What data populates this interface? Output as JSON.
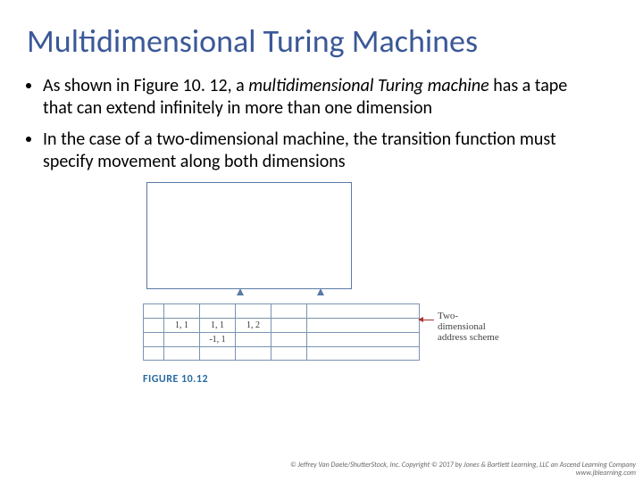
{
  "title": "Multidimensional Turing Machines",
  "bullets": [
    {
      "prefix": "As shown in Figure 10. 12, a ",
      "italic": "multidimensional Turing machine",
      "suffix": " has a tape that can extend infinitely in more than one dimension"
    },
    {
      "prefix": "In the case of a two-dimensional machine, the transition function must specify movement along both dimensions",
      "italic": "",
      "suffix": ""
    }
  ],
  "figure": {
    "cells_row2": [
      "",
      "1, 1",
      "1, 1",
      "1, 2",
      "",
      "",
      ""
    ],
    "cells_row3": [
      "",
      "",
      "-1, 1",
      "",
      "",
      "",
      ""
    ],
    "address_label_line1": "Two-dimensional",
    "address_label_line2": "address scheme",
    "caption": "FIGURE 10.12"
  },
  "copyright_line1": "© Jeffrey Van Daele/ShutterStock, Inc. Copyright © 2017 by Jones & Bartlett Learning, LLC an Ascend Learning Company",
  "copyright_line2": "www.jblearning.com"
}
